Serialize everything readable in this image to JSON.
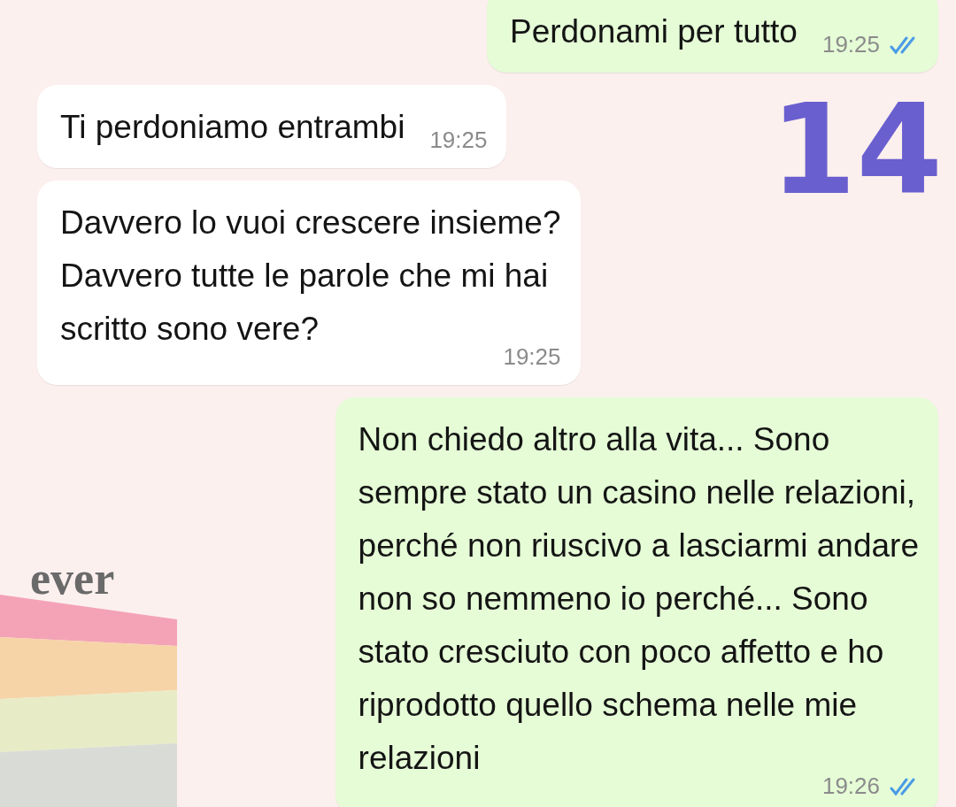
{
  "messages": [
    {
      "kind": "sent",
      "lines": [
        "Perdonami per tutto"
      ],
      "time": "19:25",
      "read": true
    },
    {
      "kind": "received",
      "lines": [
        "Ti perdoniamo entrambi"
      ],
      "time": "19:25"
    },
    {
      "kind": "received",
      "lines": [
        "Davvero lo vuoi crescere insieme?",
        "Davvero tutte le parole che mi hai",
        "scritto sono vere?"
      ],
      "time": "19:25"
    },
    {
      "kind": "sent",
      "lines": [
        "Non chiedo altro alla vita... Sono",
        "sempre stato un casino nelle relazioni,",
        "perché non riuscivo a lasciarmi andare",
        "non so nemmeno io perché... Sono",
        "stato cresciuto con poco affetto e ho",
        "riprodotto quello schema nelle mie",
        "relazioni"
      ],
      "time": "19:26",
      "read": true
    }
  ],
  "annotation": "14",
  "wallpaper_text": "ever"
}
